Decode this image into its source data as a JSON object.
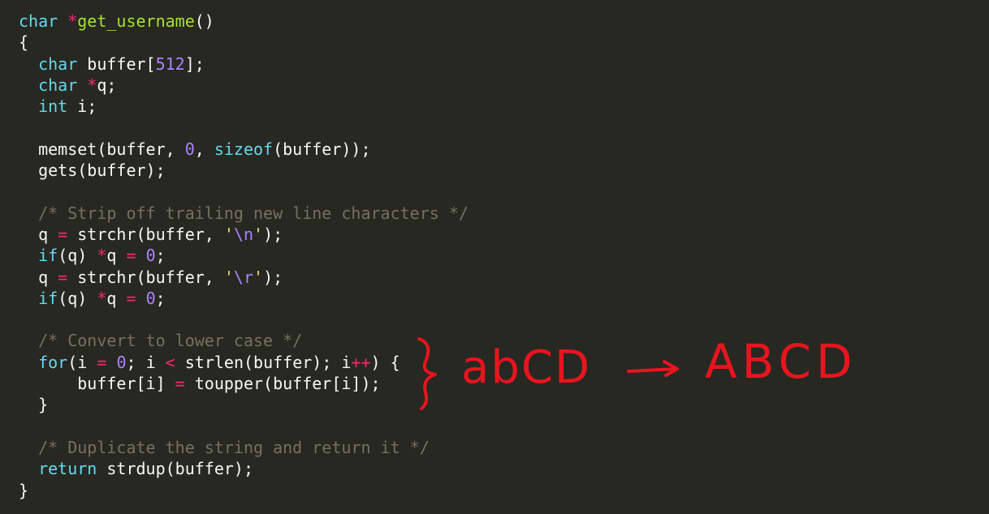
{
  "code": {
    "lines": [
      [
        {
          "t": "kw",
          "v": "char"
        },
        {
          "t": "pl",
          "v": " "
        },
        {
          "t": "op",
          "v": "*"
        },
        {
          "t": "fn",
          "v": "get_username"
        },
        {
          "t": "pl",
          "v": "()"
        }
      ],
      [
        {
          "t": "pl",
          "v": "{"
        }
      ],
      [
        {
          "t": "pl",
          "v": "  "
        },
        {
          "t": "kw",
          "v": "char"
        },
        {
          "t": "pl",
          "v": " buffer["
        },
        {
          "t": "num",
          "v": "512"
        },
        {
          "t": "pl",
          "v": "];"
        }
      ],
      [
        {
          "t": "pl",
          "v": "  "
        },
        {
          "t": "kw",
          "v": "char"
        },
        {
          "t": "pl",
          "v": " "
        },
        {
          "t": "op",
          "v": "*"
        },
        {
          "t": "pl",
          "v": "q;"
        }
      ],
      [
        {
          "t": "pl",
          "v": "  "
        },
        {
          "t": "kw",
          "v": "int"
        },
        {
          "t": "pl",
          "v": " i;"
        }
      ],
      [],
      [
        {
          "t": "pl",
          "v": "  memset(buffer, "
        },
        {
          "t": "num",
          "v": "0"
        },
        {
          "t": "pl",
          "v": ", "
        },
        {
          "t": "kw",
          "v": "sizeof"
        },
        {
          "t": "pl",
          "v": "(buffer));"
        }
      ],
      [
        {
          "t": "pl",
          "v": "  gets(buffer);"
        }
      ],
      [],
      [
        {
          "t": "pl",
          "v": "  "
        },
        {
          "t": "cm",
          "v": "/* Strip off trailing new line characters */"
        }
      ],
      [
        {
          "t": "pl",
          "v": "  q "
        },
        {
          "t": "op",
          "v": "="
        },
        {
          "t": "pl",
          "v": " strchr(buffer, "
        },
        {
          "t": "str",
          "v": "'"
        },
        {
          "t": "num",
          "v": "\\n"
        },
        {
          "t": "str",
          "v": "'"
        },
        {
          "t": "pl",
          "v": ");"
        }
      ],
      [
        {
          "t": "pl",
          "v": "  "
        },
        {
          "t": "kw",
          "v": "if"
        },
        {
          "t": "pl",
          "v": "(q) "
        },
        {
          "t": "op",
          "v": "*"
        },
        {
          "t": "pl",
          "v": "q "
        },
        {
          "t": "op",
          "v": "="
        },
        {
          "t": "pl",
          "v": " "
        },
        {
          "t": "num",
          "v": "0"
        },
        {
          "t": "pl",
          "v": ";"
        }
      ],
      [
        {
          "t": "pl",
          "v": "  q "
        },
        {
          "t": "op",
          "v": "="
        },
        {
          "t": "pl",
          "v": " strchr(buffer, "
        },
        {
          "t": "str",
          "v": "'"
        },
        {
          "t": "num",
          "v": "\\r"
        },
        {
          "t": "str",
          "v": "'"
        },
        {
          "t": "pl",
          "v": ");"
        }
      ],
      [
        {
          "t": "pl",
          "v": "  "
        },
        {
          "t": "kw",
          "v": "if"
        },
        {
          "t": "pl",
          "v": "(q) "
        },
        {
          "t": "op",
          "v": "*"
        },
        {
          "t": "pl",
          "v": "q "
        },
        {
          "t": "op",
          "v": "="
        },
        {
          "t": "pl",
          "v": " "
        },
        {
          "t": "num",
          "v": "0"
        },
        {
          "t": "pl",
          "v": ";"
        }
      ],
      [],
      [
        {
          "t": "pl",
          "v": "  "
        },
        {
          "t": "cm",
          "v": "/* Convert to lower case */"
        }
      ],
      [
        {
          "t": "pl",
          "v": "  "
        },
        {
          "t": "kw",
          "v": "for"
        },
        {
          "t": "pl",
          "v": "(i "
        },
        {
          "t": "op",
          "v": "="
        },
        {
          "t": "pl",
          "v": " "
        },
        {
          "t": "num",
          "v": "0"
        },
        {
          "t": "pl",
          "v": "; i "
        },
        {
          "t": "op",
          "v": "<"
        },
        {
          "t": "pl",
          "v": " strlen(buffer); i"
        },
        {
          "t": "op",
          "v": "++"
        },
        {
          "t": "pl",
          "v": ") {"
        }
      ],
      [
        {
          "t": "pl",
          "v": "      buffer[i] "
        },
        {
          "t": "op",
          "v": "="
        },
        {
          "t": "pl",
          "v": " toupper(buffer[i]);"
        }
      ],
      [
        {
          "t": "pl",
          "v": "  }"
        }
      ],
      [],
      [
        {
          "t": "pl",
          "v": "  "
        },
        {
          "t": "cm",
          "v": "/* Duplicate the string and return it */"
        }
      ],
      [
        {
          "t": "pl",
          "v": "  "
        },
        {
          "t": "kw",
          "v": "return"
        },
        {
          "t": "pl",
          "v": " strdup(buffer);"
        }
      ],
      [
        {
          "t": "pl",
          "v": "}"
        }
      ]
    ]
  },
  "annotation": {
    "before_text": "abCD",
    "after_text": "ABCD",
    "ink_color": "#e8141e",
    "marks": [
      "curly-brace",
      "arrow"
    ]
  },
  "theme": {
    "background": "#272822",
    "default": "#f8f8f2",
    "keyword": "#66d9ef",
    "operator": "#f92672",
    "function": "#a6e22e",
    "number": "#ae81ff",
    "string": "#e6db74",
    "comment": "#75715e"
  }
}
